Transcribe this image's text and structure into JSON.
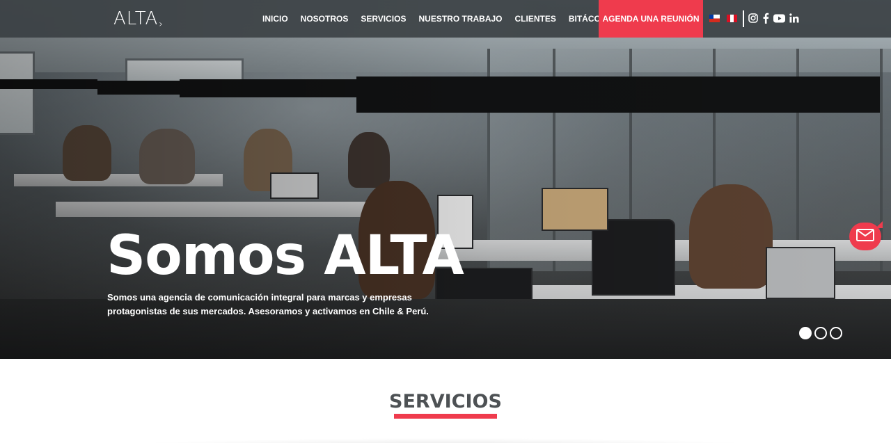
{
  "brand": {
    "logo_text": "ALTA",
    "logo_mark": "›"
  },
  "nav": {
    "items": [
      {
        "label": "INICIO"
      },
      {
        "label": "NOSOTROS"
      },
      {
        "label": "SERVICIOS"
      },
      {
        "label": "NUESTRO TRABAJO"
      },
      {
        "label": "CLIENTES"
      },
      {
        "label": "BITÁCORA"
      }
    ],
    "cta_label": "AGENDA UNA REUNIÓN",
    "flags": [
      "chile-flag-icon",
      "peru-flag-icon"
    ],
    "socials": [
      "instagram-icon",
      "facebook-icon",
      "youtube-icon",
      "linkedin-icon"
    ]
  },
  "hero": {
    "title": "Somos ALTA",
    "subtitle": "Somos una agencia de comunicación integral para marcas y empresas protagonistas de sus mercados. Asesoramos y activamos en Chile & Perú.",
    "slides_total": 3,
    "active_slide": 1,
    "image_icon": "office-photo"
  },
  "floating": {
    "mail_icon": "envelope-icon"
  },
  "services": {
    "title": "SERVICIOS"
  },
  "colors": {
    "accent": "#ef3b4d",
    "nav_bg": "#3c4246",
    "heading": "#4d5154"
  }
}
